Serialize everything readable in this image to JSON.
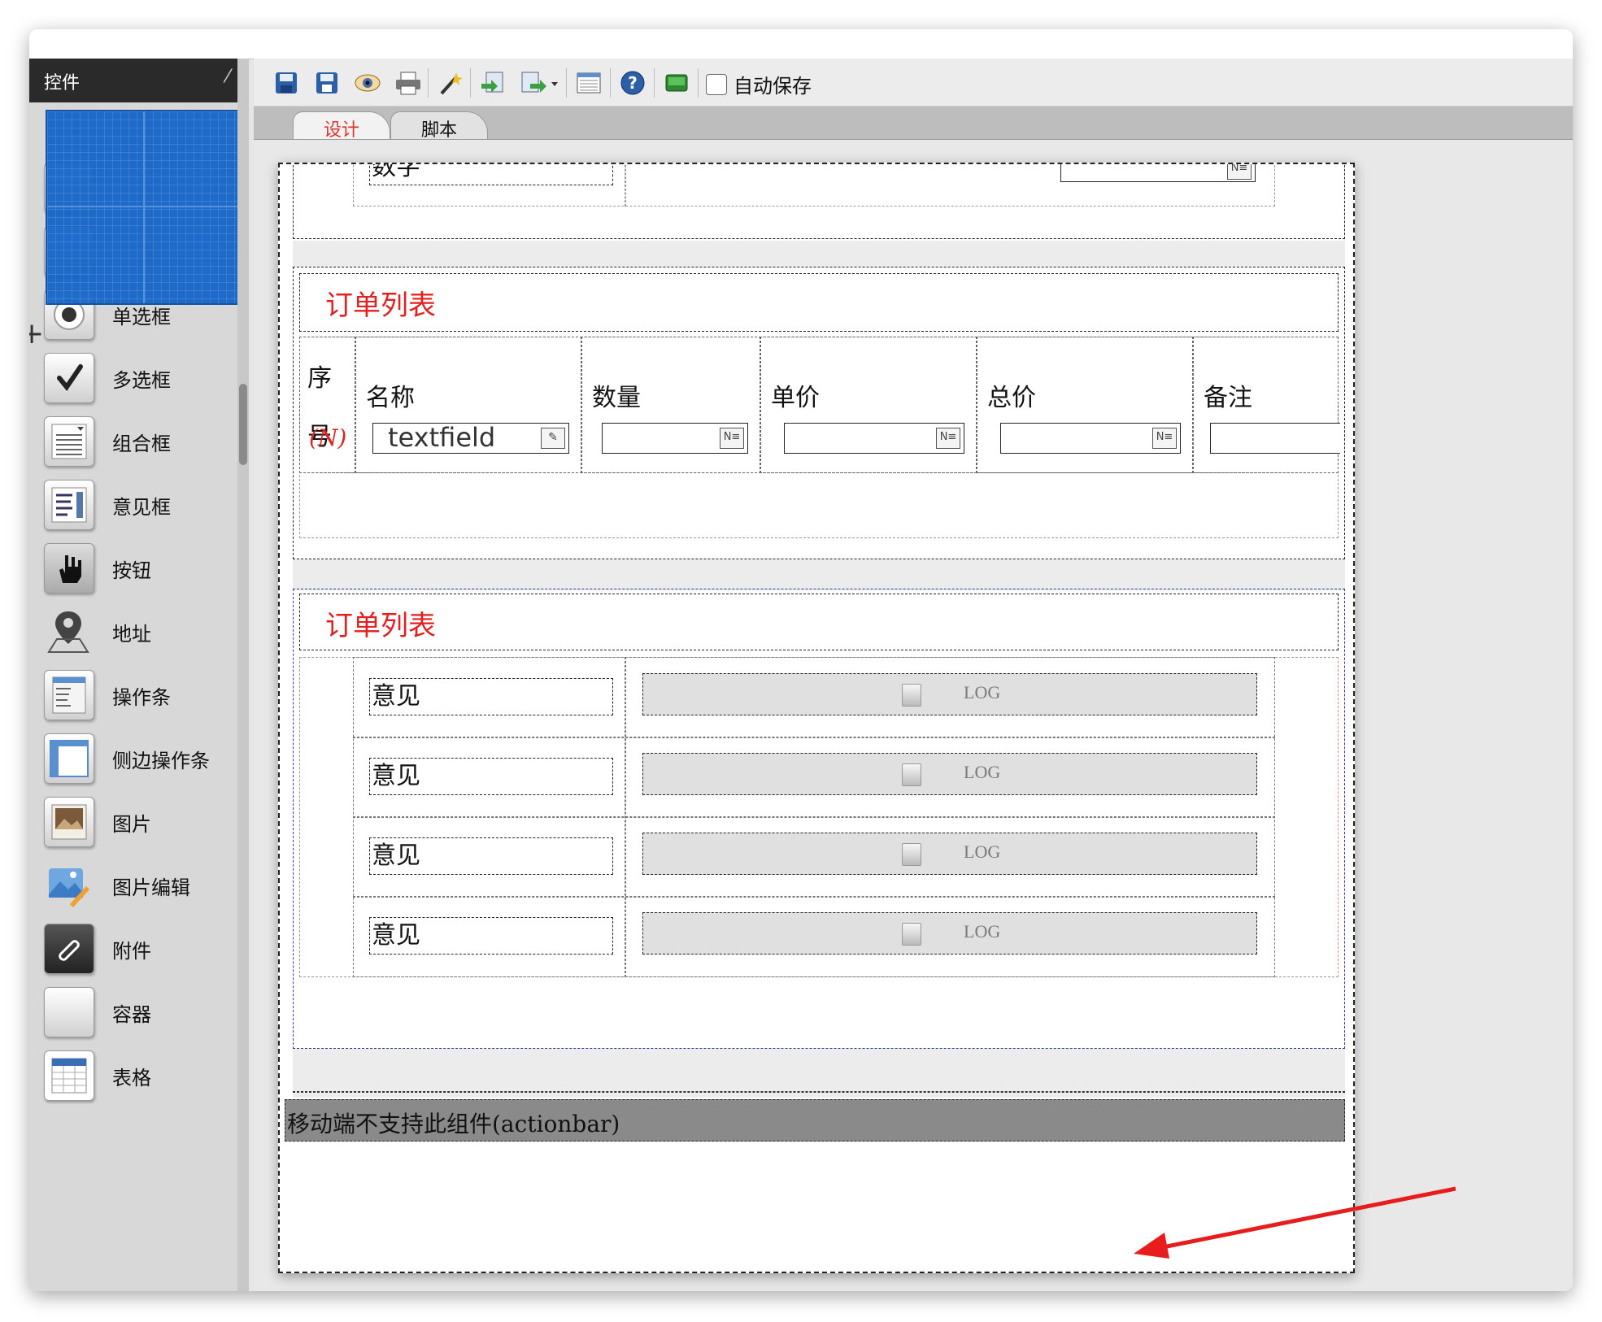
{
  "sidebar": {
    "header_text": "控件",
    "items": [
      {
        "label": "单选框",
        "icon": "radio-icon"
      },
      {
        "label": "多选框",
        "icon": "checkbox-icon"
      },
      {
        "label": "组合框",
        "icon": "combobox-icon"
      },
      {
        "label": "意见框",
        "icon": "opinion-box-icon"
      },
      {
        "label": "按钮",
        "icon": "hand-pointer-icon"
      },
      {
        "label": "地址",
        "icon": "map-pin-icon"
      },
      {
        "label": "操作条",
        "icon": "menu-list-icon"
      },
      {
        "label": "侧边操作条",
        "icon": "sidebar-layout-icon"
      },
      {
        "label": "图片",
        "icon": "photo-icon"
      },
      {
        "label": "图片编辑",
        "icon": "image-edit-icon"
      },
      {
        "label": "附件",
        "icon": "paperclip-icon"
      },
      {
        "label": "容器",
        "icon": "container-icon"
      },
      {
        "label": "表格",
        "icon": "table-icon"
      }
    ]
  },
  "toolbar": {
    "buttons": [
      "save-icon",
      "save-as-icon",
      "preview-eye-icon",
      "print-icon",
      "magic-wand-icon",
      "import-icon",
      "export-icon",
      "list-view-icon",
      "help-icon",
      "green-screen-icon"
    ],
    "autosave_label": "自动保存"
  },
  "tabs": [
    {
      "label": "设计",
      "active": true
    },
    {
      "label": "脚本",
      "active": false
    }
  ],
  "form": {
    "top_field_label": "数字",
    "table1": {
      "title": "订单列表",
      "headers": [
        "序号",
        "名称",
        "数量",
        "单价",
        "总价",
        "备注"
      ],
      "row_index": "(N)",
      "textfield_value": "textfield",
      "field_icon_text": "N≡"
    },
    "table2": {
      "title": "订单列表",
      "rows": [
        {
          "label": "意见",
          "log": "LOG"
        },
        {
          "label": "意见",
          "log": "LOG"
        },
        {
          "label": "意见",
          "log": "LOG"
        },
        {
          "label": "意见",
          "log": "LOG"
        }
      ]
    },
    "actionbar_text": "移动端不支持此组件(actionbar)"
  },
  "colors": {
    "accent_red": "#e32020",
    "drag_blue": "#1565c8",
    "actionbar_grey": "#8a8a8a"
  }
}
